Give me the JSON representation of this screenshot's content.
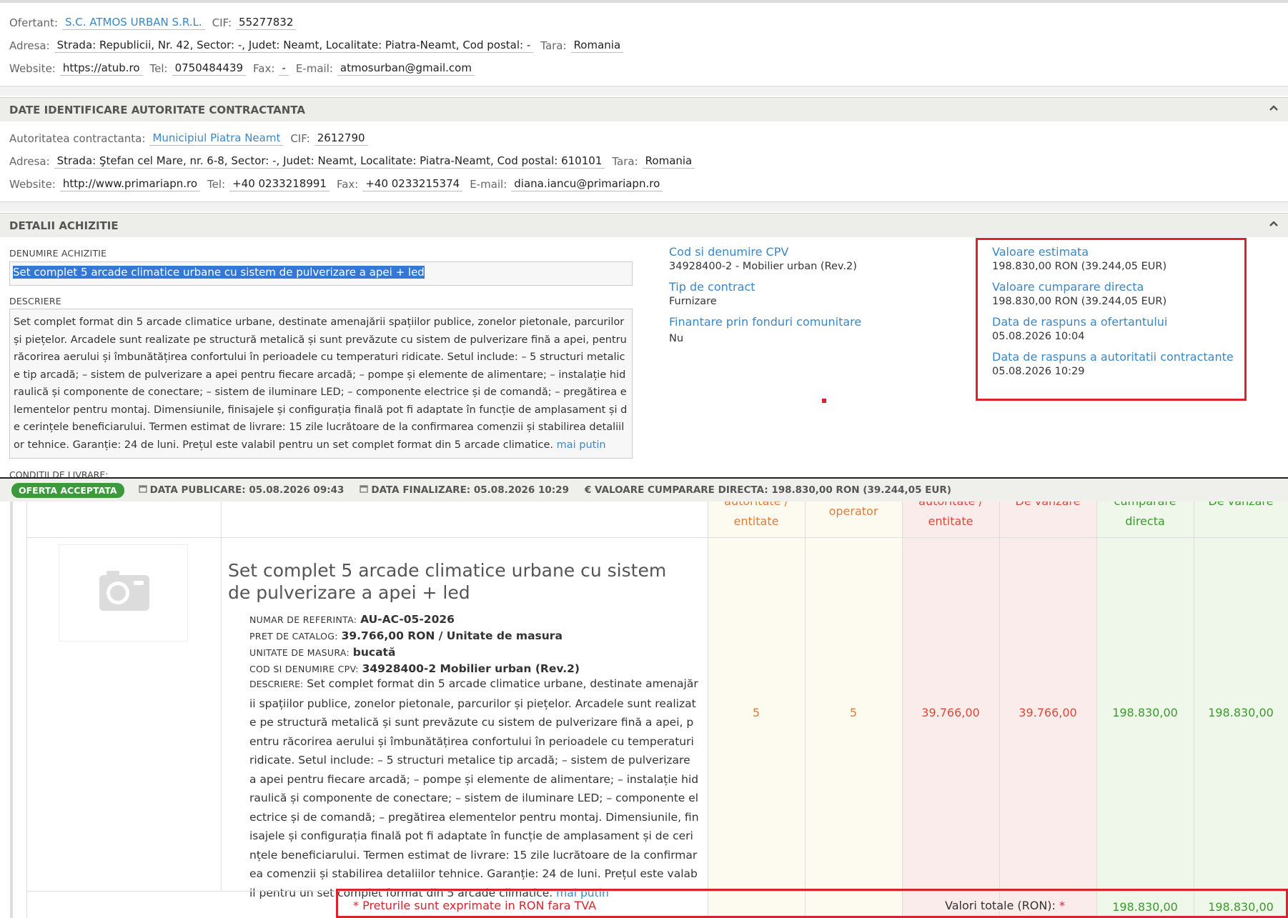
{
  "offerer": {
    "ofertant_label": "Ofertant:",
    "ofertant": "S.C. ATMOS URBAN S.R.L.",
    "cif_label": "CIF:",
    "cif": "55277832",
    "adresa_label": "Adresa:",
    "adresa": "Strada: Republicii, Nr. 42, Sector: -, Judet: Neamt, Localitate: Piatra-Neamt, Cod postal: -",
    "tara_label": "Tara:",
    "tara": "Romania",
    "website_label": "Website:",
    "website": "https://atub.ro",
    "tel_label": "Tel:",
    "tel": "0750484439",
    "fax_label": "Fax:",
    "fax": "-",
    "email_label": "E-mail:",
    "email": "atmosurban@gmail.com"
  },
  "authority": {
    "section_title": "DATE IDENTIFICARE AUTORITATE CONTRACTANTA",
    "autoritate_label": "Autoritatea contractanta:",
    "autoritate": "Municipiul Piatra Neamt",
    "cif_label": "CIF:",
    "cif": "2612790",
    "adresa_label": "Adresa:",
    "adresa": "Strada: Ştefan cel Mare, nr. 6-8, Sector: -, Judet: Neamt, Localitate: Piatra-Neamt, Cod postal: 610101",
    "tara_label": "Tara:",
    "tara": "Romania",
    "website_label": "Website:",
    "website": "http://www.primariapn.ro",
    "tel_label": "Tel:",
    "tel": "+40 0233218991",
    "fax_label": "Fax:",
    "fax": "+40 0233215374",
    "email_label": "E-mail:",
    "email": "diana.iancu@primariapn.ro"
  },
  "details": {
    "section_title": "DETALII ACHIZITIE",
    "denumire_label": "DENUMIRE ACHIZITIE",
    "denumire": "Set complet 5 arcade climatice urbane cu sistem de pulverizare a apei + led",
    "descriere_label": "DESCRIERE",
    "descriere": "Set complet format din 5 arcade climatice urbane, destinate amenajării spațiilor publice, zonelor pietonale, parcurilor și piețelor. Arcadele sunt realizate pe structură metalică și sunt prevăzute cu sistem de pulverizare fină a apei, pentru răcorirea aerului și îmbunătățirea confortului în perioadele cu temperaturi ridicate. Setul include: – 5 structuri metalice tip arcadă; – sistem de pulverizare a apei pentru fiecare arcadă; – pompe și elemente de alimentare; – instalație hidraulică și componente de conectare; – sistem de iluminare LED; – componente electrice și de comandă; – pregătirea elementelor pentru montaj. Dimensiunile, finisajele și configurația finală pot fi adaptate în funcție de amplasament și de cerințele beneficiarului. Termen estimat de livrare: 15 zile lucrătoare de la confirmarea comenzii și stabilirea detaliilor tehnice. Garanție: 24 de luni. Prețul este valabil pentru un set complet format din 5 arcade climatice.",
    "mai_putin": "mai putin",
    "conditii_label": "CONDITII DE LIVRARE:",
    "cpv_label": "Cod si denumire CPV",
    "cpv": "34928400-2 - Mobilier urban (Rev.2)",
    "tip_label": "Tip de contract",
    "tip": "Furnizare",
    "finantare_label": "Finantare prin fonduri comunitare",
    "finantare": "Nu",
    "valoare_estimata_label": "Valoare estimata",
    "valoare_estimata": "198.830,00  RON (39.244,05  EUR)",
    "valoare_cumparare_label": "Valoare cumparare directa",
    "valoare_cumparare": "198.830,00  RON (39.244,05  EUR)",
    "data_ofertant_label": "Data de raspuns a ofertantului",
    "data_ofertant": "05.08.2026 10:04",
    "data_autoritate_label": "Data de raspuns a autoritatii contractante",
    "data_autoritate": "05.08.2026 10:29"
  },
  "status_bar": {
    "badge": "OFERTA ACCEPTATA",
    "data_publicare": "DATA PUBLICARE: 05.08.2026 09:43",
    "data_finalizare": "DATA FINALIZARE: 05.08.2026 10:29",
    "valoare": "€ VALOARE CUMPARARE DIRECTA: 198.830,00  RON (39.244,05  EUR)"
  },
  "table": {
    "headers": {
      "c1": "autoritate /\nentitate",
      "c2": "operator",
      "c3": "autoritate /\nentitate",
      "c4": "De vanzare",
      "c5": "cumparare\ndirecta",
      "c6": "De vanzare"
    },
    "row": {
      "title": "Set complet 5 arcade climatice urbane cu sistem de pulverizare a apei + led",
      "ref_label": "NUMAR DE REFERINTA:",
      "ref": "AU-AC-05-2026",
      "pret_label": "PRET DE CATALOG:",
      "pret": "39.766,00  RON / Unitate de masura",
      "um_label": "UNITATE DE MASURA:",
      "um": "bucată",
      "cpv_label": "COD SI DENUMIRE CPV:",
      "cpv": "34928400-2 Mobilier urban (Rev.2)",
      "desc_label": "DESCRIERE:",
      "desc": "Set complet format din 5 arcade climatice urbane, destinate amenajării spațiilor publice, zonelor pietonale, parcurilor și piețelor. Arcadele sunt realizate pe structură metalică și sunt prevăzute cu sistem de pulverizare fină a apei, pentru răcorirea aerului și îmbunătățirea confortului în perioadele cu temperaturi ridicate. Setul include: – 5 structuri metalice tip arcadă; – sistem de pulverizare a apei pentru fiecare arcadă; – pompe și elemente de alimentare; – instalație hidraulică și componente de conectare; – sistem de iluminare LED; – componente electrice și de comandă; – pregătirea elementelor pentru montaj. Dimensiunile, finisajele și configurația finală pot fi adaptate în funcție de amplasament și de cerințele beneficiarului. Termen estimat de livrare: 15 zile lucrătoare de la confirmarea comenzii și stabilirea detaliilor tehnice. Garanție: 24 de luni. Prețul este valabil pentru un set complet format din 5 arcade climatice.",
      "mai_putin": "mai putin",
      "cantitate_autoritate": "5",
      "cantitate_operator": "5",
      "pret_autoritate": "39.766,00",
      "pret_vanzare": "39.766,00",
      "valoare_cumparare": "198.830,00",
      "valoare_vanzare": "198.830,00"
    },
    "footer": {
      "note": "* Preturile sunt exprimate in RON fara TVA",
      "totals_label": "Valori totale (RON):",
      "star": "*",
      "total1": "198.830,00",
      "total2": "198.830,00"
    }
  },
  "icons": {
    "calendar": "calendar-icon",
    "camera": "camera-placeholder-icon",
    "chevron": "chevron-up-icon"
  },
  "colors": {
    "link": "#3a87c8",
    "accent_red": "#d9232d",
    "badge_green": "#3c9a3c",
    "orange": "#e07b3a"
  }
}
